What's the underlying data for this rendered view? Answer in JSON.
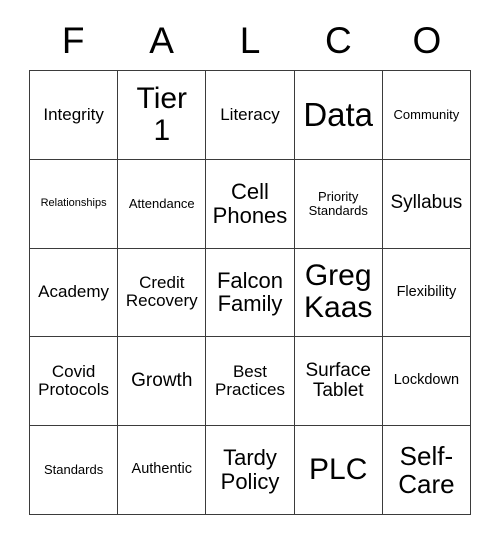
{
  "card": {
    "title_letters": [
      "F",
      "A",
      "L",
      "C",
      "O"
    ],
    "border_color": "#3b3b3b",
    "background_color": "#ffffff",
    "text_color": "#000000",
    "columns": 5,
    "rows": 5
  },
  "cells": [
    {
      "text": "Integrity",
      "size": "fs-md",
      "row": 1,
      "col": 1
    },
    {
      "text": "Tier\n1",
      "size": "fs-xxl",
      "row": 1,
      "col": 2
    },
    {
      "text": "Literacy",
      "size": "fs-md",
      "row": 1,
      "col": 3
    },
    {
      "text": "Data",
      "size": "fs-hg",
      "row": 1,
      "col": 4
    },
    {
      "text": "Community",
      "size": "fs-sm",
      "row": 1,
      "col": 5
    },
    {
      "text": "Relationships",
      "size": "fs-xs",
      "row": 2,
      "col": 1
    },
    {
      "text": "Attendance",
      "size": "fs-sm",
      "row": 2,
      "col": 2
    },
    {
      "text": "Cell\nPhones",
      "size": "fs-lg",
      "row": 2,
      "col": 3
    },
    {
      "text": "Priority\nStandards",
      "size": "fs-sm",
      "row": 2,
      "col": 4
    },
    {
      "text": "Syllabus",
      "size": "fs-mdl",
      "row": 2,
      "col": 5
    },
    {
      "text": "Academy",
      "size": "fs-md",
      "row": 3,
      "col": 1
    },
    {
      "text": "Credit\nRecovery",
      "size": "fs-md",
      "row": 3,
      "col": 2
    },
    {
      "text": "Falcon\nFamily",
      "size": "fs-lg",
      "row": 3,
      "col": 3
    },
    {
      "text": "Greg\nKaas",
      "size": "fs-xxl",
      "row": 3,
      "col": 4
    },
    {
      "text": "Flexibility",
      "size": "fs-smd",
      "row": 3,
      "col": 5
    },
    {
      "text": "Covid\nProtocols",
      "size": "fs-md",
      "row": 4,
      "col": 1
    },
    {
      "text": "Growth",
      "size": "fs-mdl",
      "row": 4,
      "col": 2
    },
    {
      "text": "Best\nPractices",
      "size": "fs-md",
      "row": 4,
      "col": 3
    },
    {
      "text": "Surface\nTablet",
      "size": "fs-mdl",
      "row": 4,
      "col": 4
    },
    {
      "text": "Lockdown",
      "size": "fs-smd",
      "row": 4,
      "col": 5
    },
    {
      "text": "Standards",
      "size": "fs-sm",
      "row": 5,
      "col": 1
    },
    {
      "text": "Authentic",
      "size": "fs-smd",
      "row": 5,
      "col": 2
    },
    {
      "text": "Tardy\nPolicy",
      "size": "fs-lg",
      "row": 5,
      "col": 3
    },
    {
      "text": "PLC",
      "size": "fs-xxl",
      "row": 5,
      "col": 4
    },
    {
      "text": "Self-\nCare",
      "size": "fs-xl",
      "row": 5,
      "col": 5
    }
  ]
}
